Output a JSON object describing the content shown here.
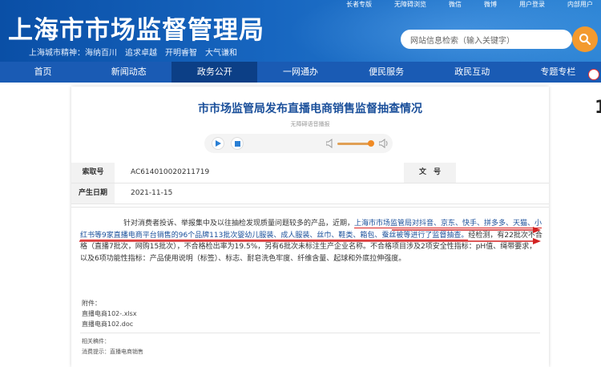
{
  "header": {
    "site_title": "上海市市场监督管理局",
    "slogans": [
      "上海城市精神：海纳百川",
      "追求卓越",
      "开明睿智",
      "大气谦和"
    ],
    "top_links": [
      "长者专版",
      "无障碍浏览",
      "微信",
      "微博",
      "用户登录",
      "内部用户"
    ],
    "search_placeholder": "网站信息检索（输入关键字）"
  },
  "nav": {
    "items": [
      "首页",
      "新闻动态",
      "政务公开",
      "一网通办",
      "便民服务",
      "政民互动",
      "专题专栏"
    ],
    "active_index": 2
  },
  "article": {
    "title": "市市场监管局发布直播电商销售监督抽查情况",
    "player_label": "无障碍语音播报",
    "meta": {
      "index_label": "索取号",
      "index_value": "AC614010020211719",
      "docno_label": "文　号",
      "date_label": "产生日期",
      "date_value": "2021-11-15"
    },
    "body": {
      "part1": "针对消费者投诉、举报集中及以往抽检发现质量问题较多的产品，近期，",
      "part2": "上海市市场监管局对抖音、京东、快手、拼多多、天猫、小红书等9家直播电商平台销售的96个品牌113批次婴幼儿服装、成人服装、丝巾、鞋类、箱包、蚕丝被等进行了监督抽查。",
      "part3": "经检测，有22批次不合格（直播7批次，网购15批次），不合格检出率为19.5%，另有6批次未标注生产企业名称。不合格项目涉及2项安全性指标：pH值、绳带要求，以及6项功能性指标：产品使用说明（标签）、标志、耐皂洗色牢度、纤维含量、起球和外底拉伸强度。"
    },
    "attachments_label": "附件：",
    "attachments": [
      "直播电商102-.xlsx",
      "直播电商102.doc"
    ],
    "related_label": "相关稿件：",
    "tip_label": "消费提示：直播电商销售"
  },
  "edge_digit": "1",
  "colors": {
    "header_start": "#0a4fa6",
    "header_end": "#2f86d6",
    "nav_bg": "#1a5bb4",
    "nav_active": "#0c3f86",
    "title_blue": "#1a4f9a",
    "search_orange": "#f39a2e",
    "annotation_red": "#d22222"
  },
  "icons": [
    "search-icon",
    "play-icon",
    "stop-icon",
    "volume-low-icon",
    "volume-high-icon",
    "accessibility-icon"
  ]
}
